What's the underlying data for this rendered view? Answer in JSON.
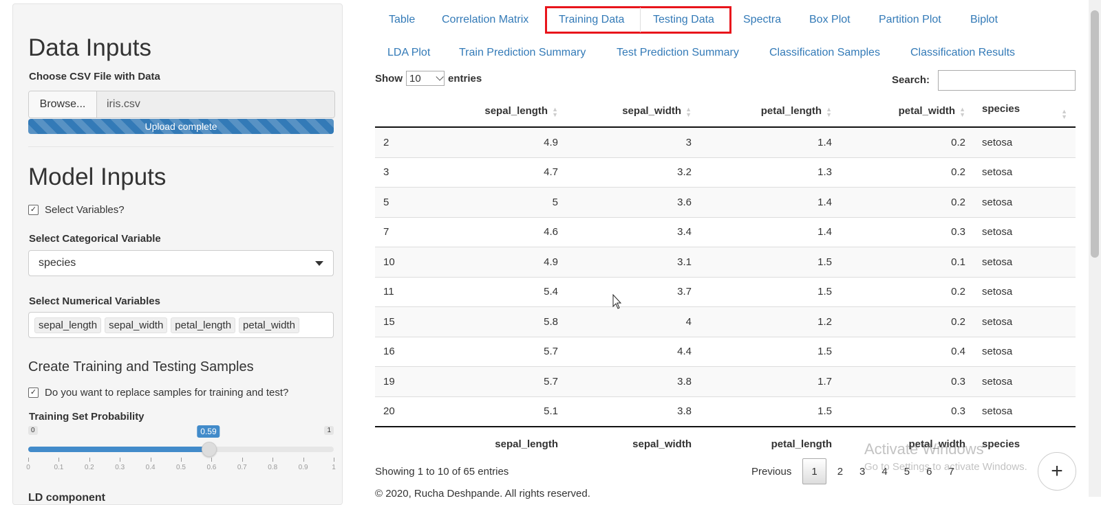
{
  "sidebar": {
    "data_inputs_title": "Data Inputs",
    "csv_label": "Choose CSV File with Data",
    "browse_label": "Browse...",
    "file_name": "iris.csv",
    "upload_status": "Upload complete",
    "model_inputs_title": "Model Inputs",
    "select_variables_label": "Select Variables?",
    "categorical_label": "Select Categorical Variable",
    "categorical_value": "species",
    "numerical_label": "Select Numerical Variables",
    "numerical_values": [
      "sepal_length",
      "sepal_width",
      "petal_length",
      "petal_width"
    ],
    "samples_title": "Create Training and Testing Samples",
    "replace_label": "Do you want to replace samples for training and test?",
    "prob_label": "Training Set Probability",
    "prob_min": "0",
    "prob_max": "1",
    "prob_value": "0.59",
    "prob_fraction": 0.59,
    "prob_ticks": [
      "0",
      "0.1",
      "0.2",
      "0.3",
      "0.4",
      "0.5",
      "0.6",
      "0.7",
      "0.8",
      "0.9",
      "1"
    ],
    "next_label_cut": "LD component"
  },
  "tabs": {
    "row1": [
      "Table",
      "Correlation Matrix",
      "Training Data",
      "Testing Data",
      "Spectra",
      "Box Plot",
      "Partition Plot",
      "Biplot"
    ],
    "row2": [
      "LDA Plot",
      "Train Prediction Summary",
      "Test Prediction Summary",
      "Classification Samples",
      "Classification Results"
    ],
    "active": "Testing Data"
  },
  "table_controls": {
    "show_label": "Show",
    "length_value": "10",
    "entries_label": "entries",
    "search_label": "Search:"
  },
  "table": {
    "columns": [
      "",
      "sepal_length",
      "sepal_width",
      "petal_length",
      "petal_width",
      "species"
    ],
    "rows": [
      [
        "2",
        "4.9",
        "3",
        "1.4",
        "0.2",
        "setosa"
      ],
      [
        "3",
        "4.7",
        "3.2",
        "1.3",
        "0.2",
        "setosa"
      ],
      [
        "5",
        "5",
        "3.6",
        "1.4",
        "0.2",
        "setosa"
      ],
      [
        "7",
        "4.6",
        "3.4",
        "1.4",
        "0.3",
        "setosa"
      ],
      [
        "10",
        "4.9",
        "3.1",
        "1.5",
        "0.1",
        "setosa"
      ],
      [
        "11",
        "5.4",
        "3.7",
        "1.5",
        "0.2",
        "setosa"
      ],
      [
        "15",
        "5.8",
        "4",
        "1.2",
        "0.2",
        "setosa"
      ],
      [
        "16",
        "5.7",
        "4.4",
        "1.5",
        "0.4",
        "setosa"
      ],
      [
        "19",
        "5.7",
        "3.8",
        "1.7",
        "0.3",
        "setosa"
      ],
      [
        "20",
        "5.1",
        "3.8",
        "1.5",
        "0.3",
        "setosa"
      ]
    ]
  },
  "info_text": "Showing 1 to 10 of 65 entries",
  "pagination": {
    "previous": "Previous",
    "pages": [
      "1",
      "2",
      "3",
      "4",
      "5",
      "6",
      "7"
    ],
    "current": "1"
  },
  "footer_text": "© 2020, Rucha Deshpande. All rights reserved.",
  "watermark": {
    "line1": "Activate Windows",
    "line2": "Go to Settings to activate Windows."
  },
  "fab_label": "+"
}
